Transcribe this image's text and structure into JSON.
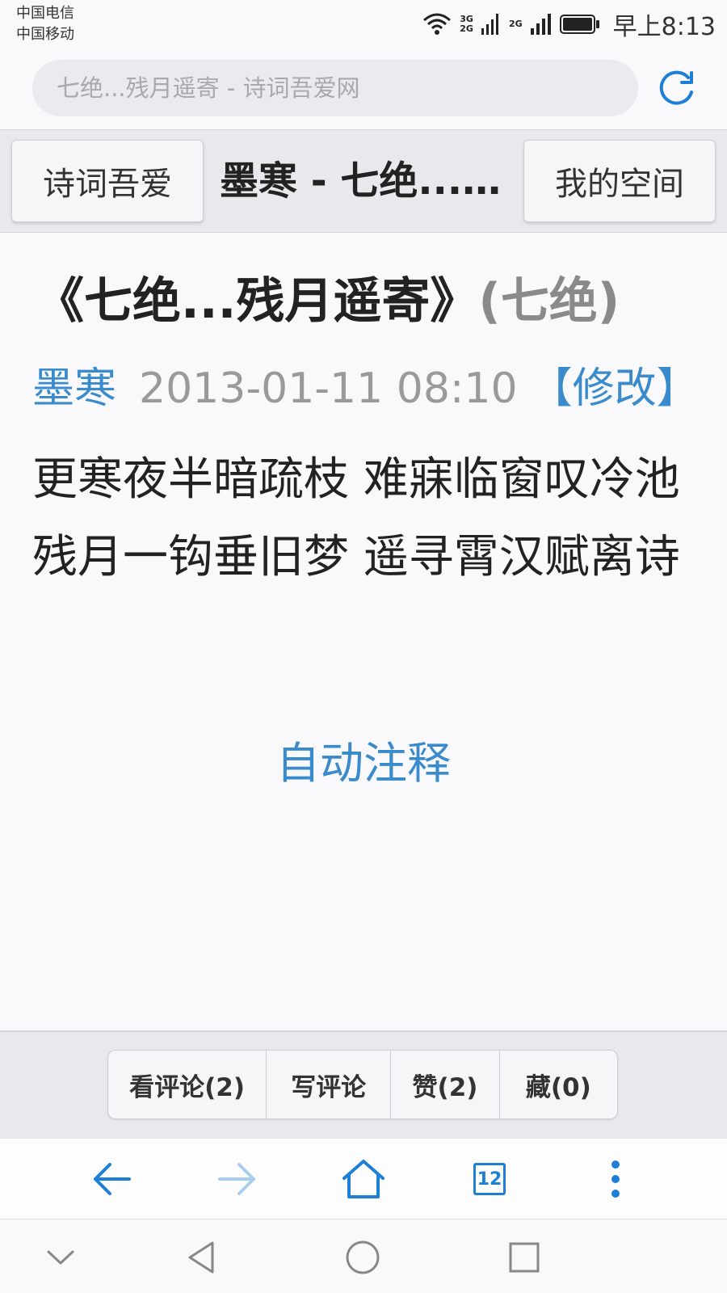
{
  "status": {
    "carrier1": "中国电信",
    "carrier2": "中国移动",
    "net1_top": "3G",
    "net1_bottom": "2G",
    "net2": "2G",
    "time": "早上8:13"
  },
  "address": {
    "url": "七绝...残月遥寄 - 诗词吾爱网"
  },
  "header": {
    "left_button": "诗词吾爱",
    "title": "墨寒 - 七绝...残月遥寄",
    "right_button": "我的空间"
  },
  "poem": {
    "title": "《七绝...残月遥寄》",
    "form": "(七绝)",
    "author": "墨寒",
    "date": "2013-01-11 08:10",
    "edit": "【修改】",
    "body": "更寒夜半暗疏枝 难寐临窗叹冷池 残月一钩垂旧梦 遥寻霄汉赋离诗",
    "annotate": "自动注释"
  },
  "actions": {
    "view_comments": "看评论(2)",
    "write_comment": "写评论",
    "like": "赞(2)",
    "collect": "藏(0)"
  },
  "browser_nav": {
    "tab_count": "12"
  },
  "colors": {
    "accent": "#1e7fd6",
    "link": "#3a8bcb"
  }
}
